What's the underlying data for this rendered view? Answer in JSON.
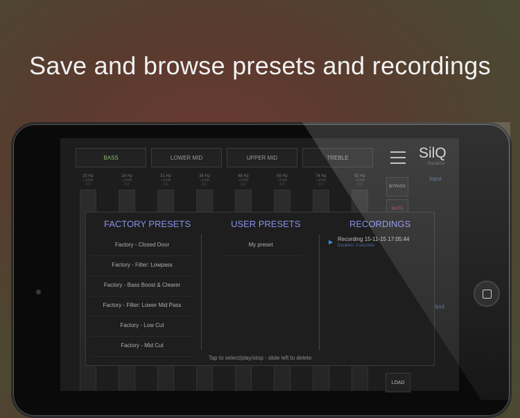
{
  "headline": "Save and browse presets and recordings",
  "app": {
    "logo": "SilQ",
    "logo_sub": "Equalizer",
    "bands": [
      "BASS",
      "LOWER MID",
      "UPPER MID",
      "TREBLE"
    ],
    "frequencies": [
      "20 Hz",
      "24 Hz",
      "31 Hz",
      "38 Hz",
      "48 Hz",
      "59 Hz",
      "74 Hz",
      "92 Hz"
    ],
    "db_values": [
      "+10dB",
      "+10dB",
      "+10dB",
      "+10dB",
      "+10dB",
      "+10dB",
      "+10dB",
      "+10dB"
    ],
    "gain_values": [
      "0.0",
      "0.0",
      "0.0",
      "0.0",
      "0.0",
      "0.0",
      "0.0",
      "0.0"
    ],
    "bypass_label": "BYPASS",
    "mute_label": "MUTE",
    "input_label": "Input",
    "output_label": "Output",
    "load_label": "LOAD"
  },
  "panel": {
    "factory_title": "FACTORY PRESETS",
    "user_title": "USER PRESETS",
    "recordings_title": "RECORDINGS",
    "factory_presets": [
      "Factory - Closed Door",
      "Factory - Filter: Lowpass",
      "Factory - Bass Boost & Clearer",
      "Factory - Filter: Lower Mid Pass",
      "Factory - Low Cut",
      "Factory - Mid Cut"
    ],
    "user_presets": [
      "My preset"
    ],
    "recording": {
      "name": "Recording 15-11-15 17:05:44",
      "duration": "Duration: 3 seconds"
    },
    "hint": "Tap to select/play/stop - slide left to delete"
  },
  "colors": {
    "accent_blue": "#8890e8",
    "play_blue": "#3b8fe0",
    "active_band": "#8ab86a"
  }
}
